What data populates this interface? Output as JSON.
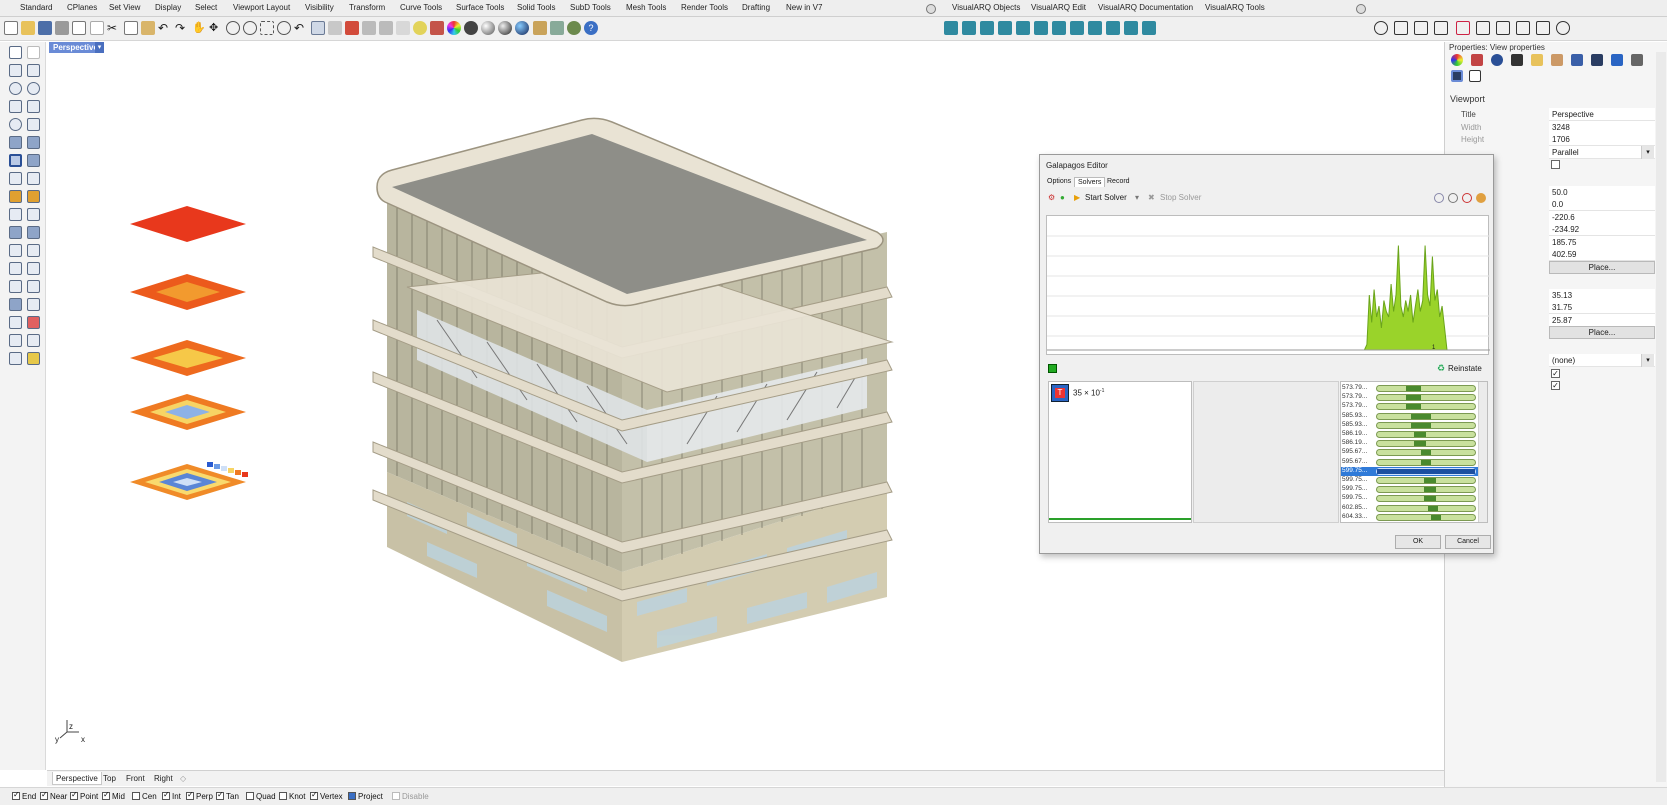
{
  "toolbar": {
    "tabs": [
      "Standard",
      "CPlanes",
      "Set View",
      "Display",
      "Select",
      "Viewport Layout",
      "Visibility",
      "Transform",
      "Curve Tools",
      "Surface Tools",
      "Solid Tools",
      "SubD Tools",
      "Mesh Tools",
      "Render Tools",
      "Drafting",
      "New in V7"
    ],
    "varq_tabs": [
      "VisualARQ Objects",
      "VisualARQ Edit",
      "VisualARQ Documentation",
      "VisualARQ Tools"
    ]
  },
  "viewport": {
    "label": "Perspective",
    "dropdown": "▾",
    "axis_y": "y",
    "axis_x": "x",
    "axis_z": "z"
  },
  "view_tabs": [
    "Perspective",
    "Top",
    "Front",
    "Right"
  ],
  "view_tab_add": "◇",
  "osnap": [
    {
      "label": "End",
      "checked": true
    },
    {
      "label": "Near",
      "checked": true
    },
    {
      "label": "Point",
      "checked": true
    },
    {
      "label": "Mid",
      "checked": true
    },
    {
      "label": "Cen",
      "checked": false
    },
    {
      "label": "Int",
      "checked": true
    },
    {
      "label": "Perp",
      "checked": true
    },
    {
      "label": "Tan",
      "checked": true
    },
    {
      "label": "Quad",
      "checked": false
    },
    {
      "label": "Knot",
      "checked": false
    },
    {
      "label": "Vertex",
      "checked": true
    },
    {
      "label": "Project",
      "checked": false
    },
    {
      "label": "Disable",
      "checked": false
    }
  ],
  "properties": {
    "title": "Properties: View properties",
    "section": "Viewport",
    "rows": [
      {
        "label": "Title",
        "value": "Perspective",
        "kind": "text"
      },
      {
        "label": "Width",
        "value": "3248",
        "kind": "text",
        "gray": true
      },
      {
        "label": "Height",
        "value": "1706",
        "kind": "text",
        "gray": true
      },
      {
        "label": "",
        "value": "Parallel",
        "kind": "dropdown"
      },
      {
        "label": "",
        "value": "",
        "kind": "check",
        "checked": false
      },
      {
        "label": "ath",
        "value": "50.0",
        "kind": "text"
      },
      {
        "label": "",
        "value": "0.0",
        "kind": "text"
      },
      {
        "label": "",
        "value": "-220.6",
        "kind": "text"
      },
      {
        "label": "",
        "value": "-234.92",
        "kind": "text"
      },
      {
        "label": "",
        "value": "185.75",
        "kind": "text"
      },
      {
        "label": "o Target",
        "value": "402.59",
        "kind": "text"
      },
      {
        "label": "",
        "value": "Place...",
        "kind": "button"
      },
      {
        "label": "",
        "value": "35.13",
        "kind": "text"
      },
      {
        "label": "",
        "value": "31.75",
        "kind": "text"
      },
      {
        "label": "",
        "value": "25.87",
        "kind": "text"
      },
      {
        "label": "",
        "value": "Place...",
        "kind": "button"
      },
      {
        "label": "",
        "value": "(none)",
        "kind": "dropdown"
      },
      {
        "label": "",
        "value": "",
        "kind": "check",
        "checked": true
      },
      {
        "label": "",
        "value": "",
        "kind": "check",
        "checked": true
      }
    ]
  },
  "galapagos": {
    "title": "Galapagos Editor",
    "tabs": [
      "Options",
      "Solvers",
      "Record"
    ],
    "active_tab": "Solvers",
    "start_solver": "Start Solver",
    "stop_solver": "Stop Solver",
    "reinstate": "Reinstate",
    "axis_tick": "1",
    "fitness_label": "35 × 10",
    "fitness_exp": "-1",
    "ok": "OK",
    "cancel": "Cancel",
    "genomes": [
      {
        "value": "573.79...",
        "mark": [
          0.3,
          0.45
        ]
      },
      {
        "value": "573.79...",
        "mark": [
          0.3,
          0.45
        ]
      },
      {
        "value": "573.79...",
        "mark": [
          0.3,
          0.45
        ]
      },
      {
        "value": "585.93...",
        "mark": [
          0.35,
          0.55
        ]
      },
      {
        "value": "585.93...",
        "mark": [
          0.35,
          0.55
        ]
      },
      {
        "value": "586.19...",
        "mark": [
          0.38,
          0.5
        ]
      },
      {
        "value": "586.19...",
        "mark": [
          0.38,
          0.5
        ]
      },
      {
        "value": "595.67...",
        "mark": [
          0.45,
          0.55
        ]
      },
      {
        "value": "595.67...",
        "mark": [
          0.45,
          0.55
        ]
      },
      {
        "value": "599.75...",
        "mark": [
          0.0,
          1.0
        ],
        "selected": true
      },
      {
        "value": "599.75...",
        "mark": [
          0.48,
          0.6
        ]
      },
      {
        "value": "599.75...",
        "mark": [
          0.48,
          0.6
        ]
      },
      {
        "value": "599.75...",
        "mark": [
          0.48,
          0.6
        ]
      },
      {
        "value": "602.85...",
        "mark": [
          0.52,
          0.62
        ]
      },
      {
        "value": "604.33...",
        "mark": [
          0.55,
          0.65
        ]
      }
    ],
    "graph_series": [
      0.0,
      0.0,
      0.05,
      0.5,
      0.25,
      0.55,
      0.3,
      0.4,
      0.2,
      0.45,
      0.35,
      0.3,
      0.6,
      0.35,
      0.5,
      0.95,
      0.4,
      0.3,
      0.45,
      0.35,
      0.5,
      0.25,
      0.4,
      0.55,
      0.35,
      0.45,
      0.95,
      0.5,
      0.4,
      0.85,
      0.45,
      0.55,
      0.3,
      0.4,
      0.2,
      0.0
    ]
  }
}
